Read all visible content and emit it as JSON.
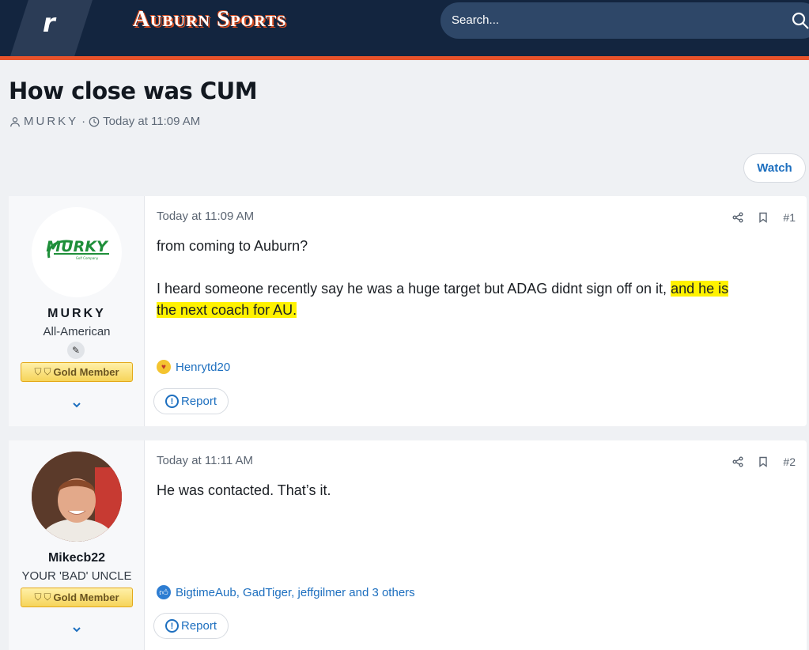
{
  "header": {
    "logo_letter": "r",
    "brand": "Auburn Sports",
    "search_placeholder": "Search..."
  },
  "thread": {
    "title": "How close was CUM",
    "author": "MURKY",
    "separator": "·",
    "time": "Today at 11:09 AM",
    "watch_label": "Watch"
  },
  "posts": [
    {
      "username": "MURKY",
      "user_title": "All-American",
      "badge": "Gold Member",
      "avatar_text": "MURKY",
      "avatar_subtext": "Golf Company",
      "date": "Today at 11:09 AM",
      "number": "#1",
      "body_line1": "from coming to Auburn?",
      "body_para2_plain": "I heard someone recently say he was a huge target but ADAG didnt sign off on it, ",
      "body_para2_highlight1": "and he is",
      "body_para2_highlight2": "the next coach for AU.",
      "reactions": "Henrytd20",
      "report_label": "Report"
    },
    {
      "username": "Mikecb22",
      "user_title": "YOUR 'BAD' UNCLE",
      "badge": "Gold Member",
      "date": "Today at 11:11 AM",
      "number": "#2",
      "body_line1": "He was contacted. That’s it.",
      "reactions": "BigtimeAub, GadTiger, jeffgilmer and 3 others",
      "report_label": "Report"
    }
  ],
  "colors": {
    "header_bg": "#13253f",
    "accent": "#e8532b",
    "link": "#1d6fbf",
    "highlight": "#fff200"
  }
}
